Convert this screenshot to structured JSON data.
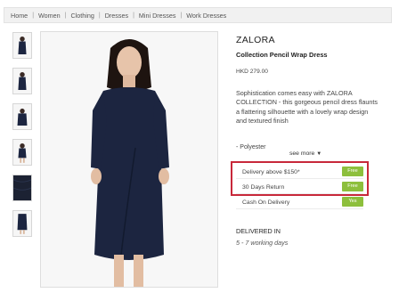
{
  "breadcrumb": [
    "Home",
    "Women",
    "Clothing",
    "Dresses",
    "Mini Dresses",
    "Work Dresses"
  ],
  "breadcrumb_separator": "|",
  "product": {
    "brand": "ZALORA",
    "name": "Collection Pencil Wrap Dress",
    "price": "HKD 279.00",
    "description": "Sophistication comes easy with ZALORA COLLECTION - this gorgeous pencil dress flaunts a flattering silhouette with a lovely wrap design and textured finish",
    "bullet": "- Polyester",
    "see_more": "see more"
  },
  "delivery_options": [
    {
      "label": "Delivery above $150*",
      "badge": "Free"
    },
    {
      "label": "30 Days Return",
      "badge": "Free"
    },
    {
      "label": "Cash On Delivery",
      "badge": "Yes"
    }
  ],
  "delivered": {
    "label": "DELIVERED IN",
    "days": "5 - 7 working days"
  },
  "colors": {
    "dress": "#1c2540",
    "badge_green": "#8dbf3c",
    "highlight_red": "#c8283a"
  }
}
